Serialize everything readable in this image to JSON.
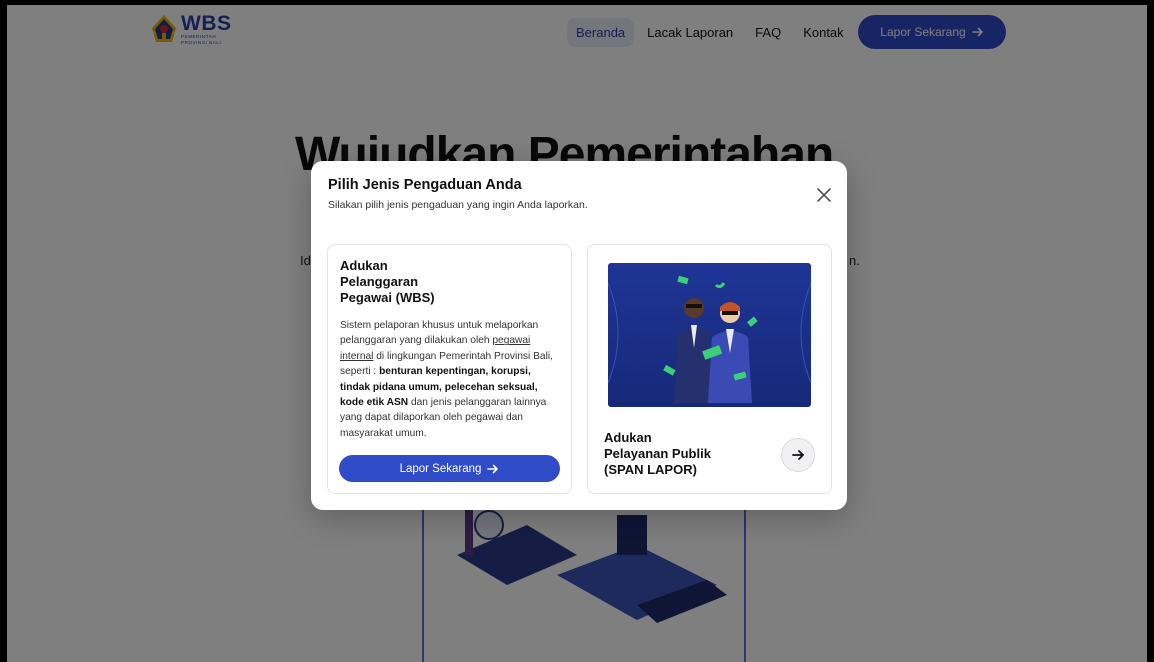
{
  "brand": {
    "name": "WBS",
    "subtitle_line1": "PEMERINTAH",
    "subtitle_line2": "PROVINSI BALI"
  },
  "nav": {
    "items": [
      {
        "label": "Beranda",
        "active": true
      },
      {
        "label": "Lacak Laporan",
        "active": false
      },
      {
        "label": "FAQ",
        "active": false
      },
      {
        "label": "Kontak",
        "active": false
      }
    ],
    "cta_label": "Lapor Sekarang",
    "accent_color": "#2f4bc8"
  },
  "hero": {
    "title_visible": "Wujudkan Pemerintahan",
    "text_left_fragment": "Id",
    "text_right_fragment": "n."
  },
  "modal": {
    "title": "Pilih Jenis Pengaduan Anda",
    "subtitle": "Silakan pilih jenis pengaduan yang ingin Anda laporkan.",
    "close_icon": "close-icon",
    "card_wbs": {
      "title_line1": "Adukan",
      "title_line2": "Pelanggaran",
      "title_line3": "Pegawai (WBS)",
      "desc_part1": "Sistem pelaporan khusus untuk melaporkan pelanggaran yang dilakukan oleh ",
      "desc_link": "pegawai internal",
      "desc_part2": " di lingkungan Pemerintah Provinsi Bali, seperti : ",
      "desc_bold": "benturan kepentingan, korupsi, tindak pidana umum, pelecehan seksual, kode etik ASN",
      "desc_part3": " dan jenis pelanggaran lainnya yang dapat dilaporkan oleh pegawai dan masyarakat umum.",
      "button_label": "Lapor Sekarang"
    },
    "card_span": {
      "title_line1": "Adukan",
      "title_line2": "Pelayanan Publik",
      "title_line3": "(SPAN LAPOR)",
      "arrow_icon": "arrow-right-icon"
    }
  }
}
